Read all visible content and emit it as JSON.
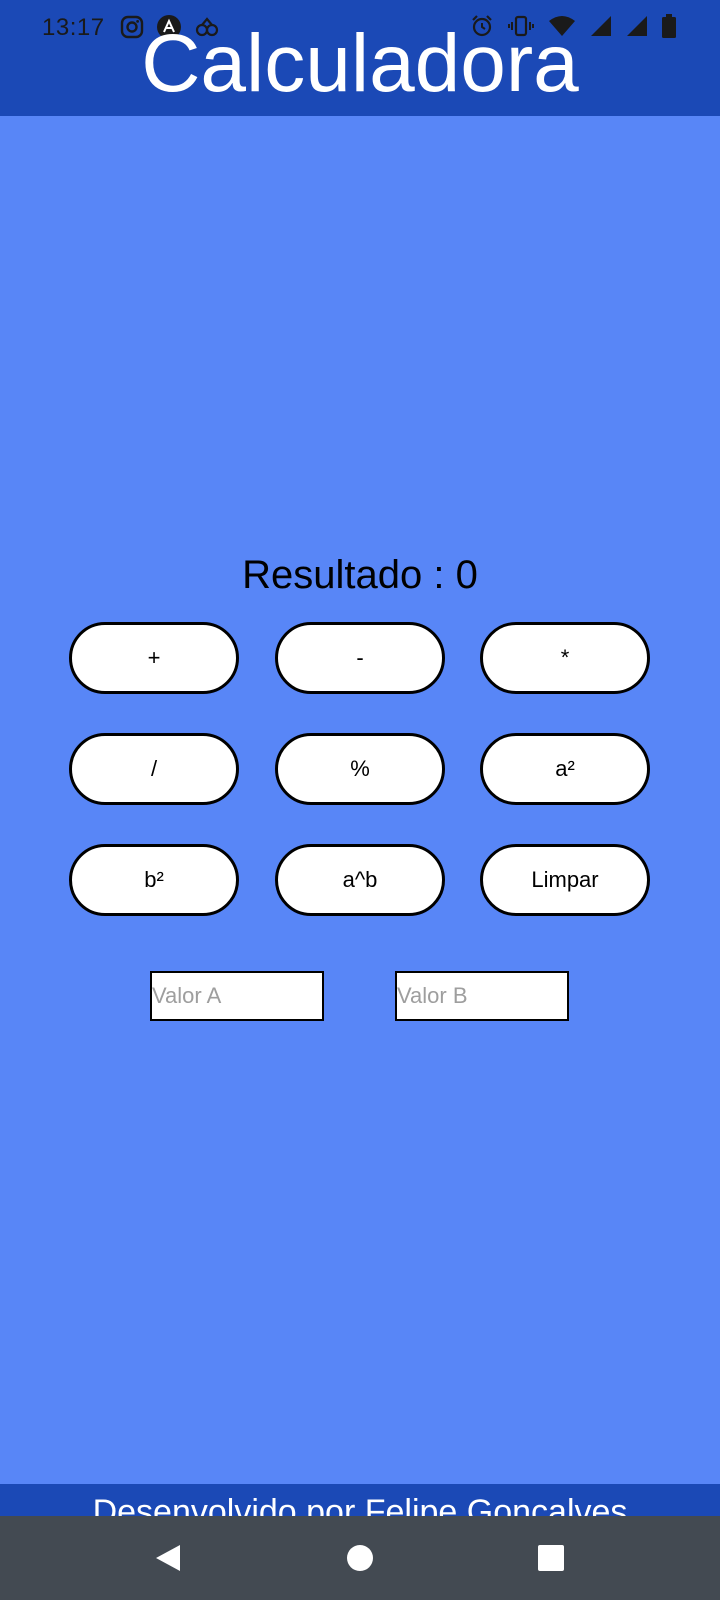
{
  "status_bar": {
    "time": "13:17",
    "left_icons": [
      "instagram-icon",
      "app-notification-icon",
      "bug-icon"
    ],
    "right_icons": [
      "alarm-icon",
      "vibrate-icon",
      "wifi-icon",
      "signal-icon",
      "signal-icon",
      "battery-icon"
    ]
  },
  "header": {
    "title": "Calculadora"
  },
  "main": {
    "result_label": "Resultado : 0",
    "buttons": [
      "+",
      "-",
      "*",
      "/",
      "%",
      "a²",
      "b²",
      "a^b",
      "Limpar"
    ],
    "input_a_placeholder": "Valor A",
    "input_b_placeholder": "Valor B"
  },
  "footer": {
    "text": "Desenvolvido por Felipe Goncalves"
  },
  "nav": {
    "icons": [
      "back-icon",
      "home-icon",
      "recents-icon"
    ]
  },
  "colors": {
    "background": "#5886f7",
    "header": "#1b49b6",
    "nav_bar": "#434a52"
  }
}
